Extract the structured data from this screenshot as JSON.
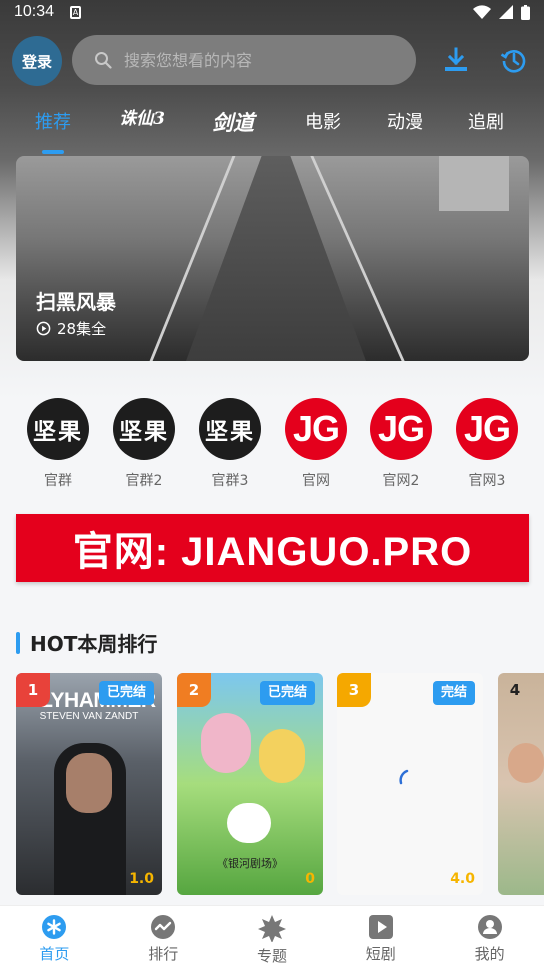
{
  "status": {
    "time": "10:34",
    "notif": "A"
  },
  "topbar": {
    "login_label": "登录",
    "search_placeholder": "搜索您想看的内容"
  },
  "tabs": [
    {
      "label": "推荐",
      "active": true
    },
    {
      "label": "诛仙3",
      "kind": "logo"
    },
    {
      "label": "剑道",
      "kind": "logo"
    },
    {
      "label": "电影"
    },
    {
      "label": "动漫"
    },
    {
      "label": "追剧"
    }
  ],
  "banner": {
    "title": "扫黑风暴",
    "episodes": "28集全"
  },
  "circles": [
    {
      "label": "官群",
      "style": "black",
      "text": "坚果"
    },
    {
      "label": "官群2",
      "style": "black",
      "text": "坚果"
    },
    {
      "label": "官群3",
      "style": "black",
      "text": "坚果"
    },
    {
      "label": "官网",
      "style": "red",
      "text": "JG"
    },
    {
      "label": "官网2",
      "style": "red",
      "text": "JG"
    },
    {
      "label": "官网3",
      "style": "red",
      "text": "JG"
    }
  ],
  "ad": {
    "text": "官网: JIANGUO.PRO"
  },
  "section": {
    "title": "HOT本周排行"
  },
  "cards": [
    {
      "rank": "1",
      "badge": "已完结",
      "score": "1.0",
      "poster_text": "LILYHAMMER",
      "poster_sub": "STEVEN VAN ZANDT",
      "rank_color": "#e8423a"
    },
    {
      "rank": "2",
      "badge": "已完结",
      "score": "0",
      "poster_text": "《银河剧场》",
      "rank_color": "#f07d22"
    },
    {
      "rank": "3",
      "badge": "完结",
      "score": "4.0",
      "rank_color": "#f5a800"
    },
    {
      "rank": "4",
      "rank_color": "#333333"
    }
  ],
  "nav": [
    {
      "label": "首页",
      "icon": "home-asterisk-icon",
      "active": true
    },
    {
      "label": "排行",
      "icon": "rank-wave-icon"
    },
    {
      "label": "专题",
      "icon": "topic-star-icon"
    },
    {
      "label": "短剧",
      "icon": "play-box-icon"
    },
    {
      "label": "我的",
      "icon": "user-icon"
    }
  ],
  "colors": {
    "accent": "#2d9cf0",
    "brand_red": "#e4001c"
  }
}
